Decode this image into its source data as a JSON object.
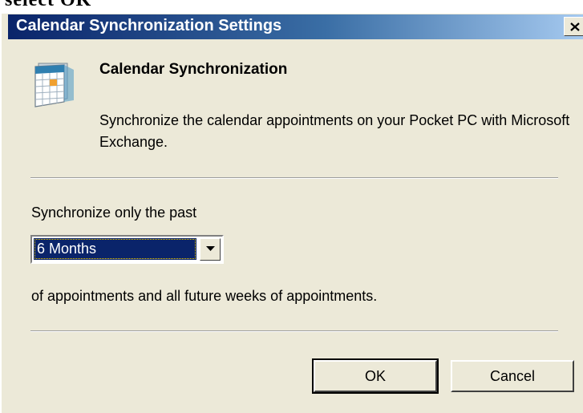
{
  "top_clip_text": "select OK",
  "window": {
    "title": "Calendar Synchronization Settings",
    "close_icon": "close-icon"
  },
  "header": {
    "icon": "calendar-icon",
    "heading": "Calendar Synchronization",
    "description": "Synchronize the calendar appointments on your Pocket PC with Microsoft Exchange."
  },
  "sync": {
    "label": "Synchronize only the past",
    "selected_value": "6 Months",
    "suffix_label": "of appointments and all future weeks of appointments."
  },
  "buttons": {
    "ok_label": "OK",
    "cancel_label": "Cancel"
  },
  "colors": {
    "titlebar_start": "#0a246a",
    "titlebar_end": "#a6caf0",
    "dialog_bg": "#ece9d8",
    "selection_bg": "#0a246a"
  }
}
